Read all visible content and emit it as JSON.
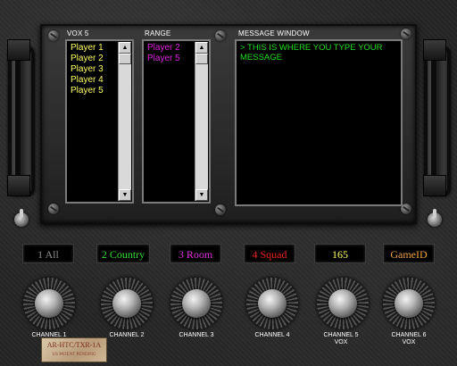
{
  "panels": {
    "vox": {
      "label": "VOX 5",
      "players": [
        "Player 1",
        "Player 2",
        "Player 3",
        "Player 4",
        "Player 5"
      ],
      "text_color": "#ffff66"
    },
    "range": {
      "label": "RANGE",
      "players": [
        "Player 2",
        "Player 5"
      ],
      "text_color": "#dd22dd"
    },
    "message": {
      "label": "MESSAGE WINDOW",
      "text": "> THIS IS WHERE YOU TYPE YOUR MESSAGE",
      "text_color": "#22dd22"
    }
  },
  "channels": [
    {
      "box": "1 All",
      "box_color": "#8a8a8a",
      "label_line1": "CHANNEL 1",
      "label_line2": ""
    },
    {
      "box": "2 Country",
      "box_color": "#33dd33",
      "label_line1": "CHANNEL 2",
      "label_line2": ""
    },
    {
      "box": "3 Room",
      "box_color": "#dd33dd",
      "label_line1": "CHANNEL 3",
      "label_line2": ""
    },
    {
      "box": "4 Squad",
      "box_color": "#ee2222",
      "label_line1": "CHANNEL 4",
      "label_line2": ""
    },
    {
      "box": "165",
      "box_color": "#ffff66",
      "label_line1": "CHANNEL 5",
      "label_line2": "VOX"
    },
    {
      "box": "GameID",
      "box_color": "#f0a040",
      "label_line1": "CHANNEL 6",
      "label_line2": "VOX"
    }
  ],
  "tag": {
    "line1": "AR-HTC/TXR-1A",
    "line2": "US PATENT PENDING"
  },
  "icons": {
    "scroll_up": "▲",
    "scroll_down": "▼"
  }
}
